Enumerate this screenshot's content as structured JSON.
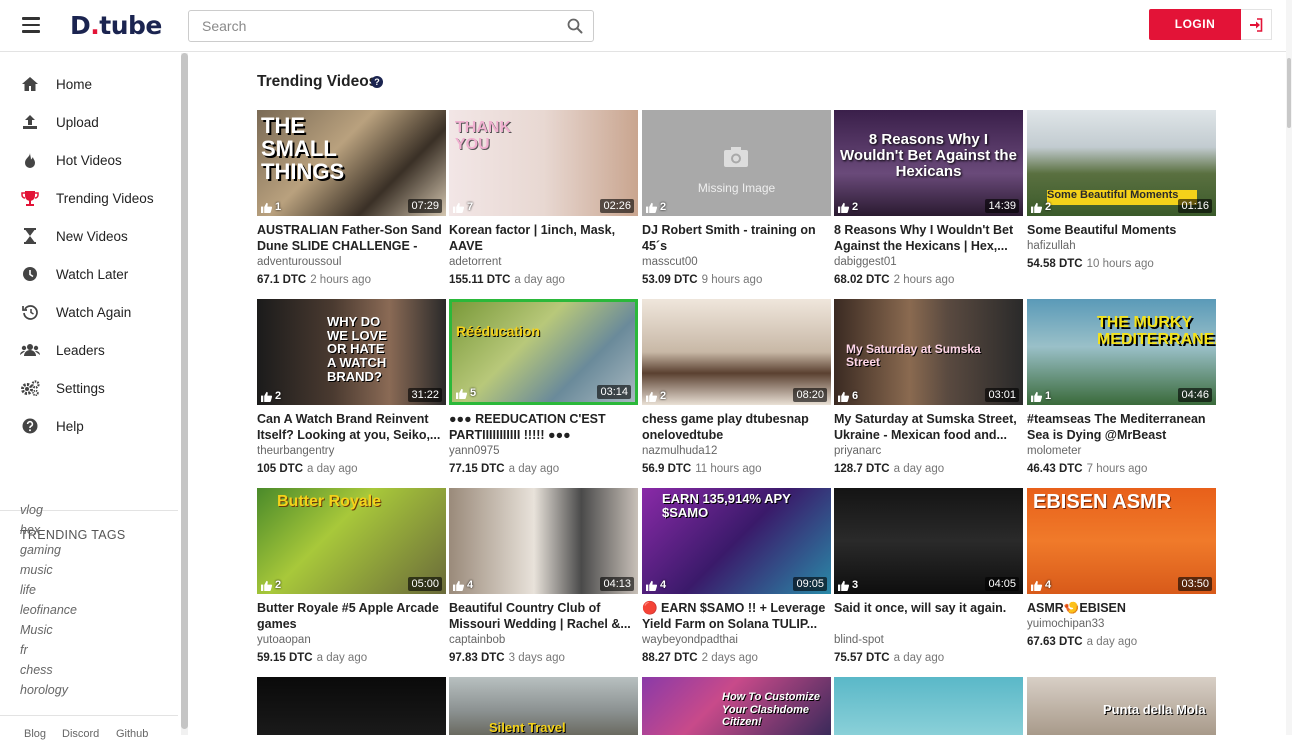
{
  "header": {
    "logo_d": "D",
    "logo_dot": ".",
    "logo_rest": "tube",
    "search_placeholder": "Search",
    "login_label": "LOGIN"
  },
  "sidebar": {
    "items": [
      {
        "label": "Home",
        "icon": "home-icon"
      },
      {
        "label": "Upload",
        "icon": "upload-icon"
      },
      {
        "label": "Hot Videos",
        "icon": "fire-icon"
      },
      {
        "label": "Trending Videos",
        "icon": "trophy-icon"
      },
      {
        "label": "New Videos",
        "icon": "hourglass-icon"
      },
      {
        "label": "Watch Later",
        "icon": "clock-icon"
      },
      {
        "label": "Watch Again",
        "icon": "history-icon"
      },
      {
        "label": "Leaders",
        "icon": "users-icon"
      },
      {
        "label": "Settings",
        "icon": "cogs-icon"
      },
      {
        "label": "Help",
        "icon": "question-icon"
      }
    ],
    "tags_title": "TRENDING TAGS",
    "tags": [
      "vlog",
      "hex",
      "gaming",
      "music",
      "life",
      "leofinance",
      "Music",
      "fr",
      "chess",
      "horology"
    ],
    "footer_links": [
      "Blog",
      "Discord",
      "Github"
    ]
  },
  "main": {
    "title": "Trending Videos",
    "videos": [
      {
        "title": "AUSTRALIAN Father-Son Sand Dune SLIDE CHALLENGE - The...",
        "author": "adventuroussoul",
        "dtc": "67.1 DTC",
        "ago": "2 hours ago",
        "likes": "1",
        "duration": "07:29",
        "overlay": "THE SMALL THINGS"
      },
      {
        "title": "Korean factor | 1inch, Mask, AAVE",
        "author": "adetorrent",
        "dtc": "155.11 DTC",
        "ago": "a day ago",
        "likes": "7",
        "duration": "02:26",
        "overlay": "THANK YOU"
      },
      {
        "title": "DJ Robert Smith - training on 45´s",
        "author": "masscut00",
        "dtc": "53.09 DTC",
        "ago": "9 hours ago",
        "likes": "2",
        "duration": "",
        "overlay": "Missing Image"
      },
      {
        "title": "8 Reasons Why I Wouldn't Bet Against the Hexicans | Hex,...",
        "author": "dabiggest01",
        "dtc": "68.02 DTC",
        "ago": "2 hours ago",
        "likes": "2",
        "duration": "14:39",
        "overlay": "8 Reasons Why I Wouldn't Bet Against the Hexicans"
      },
      {
        "title": "Some Beautiful Moments",
        "author": "hafizullah",
        "dtc": "54.58 DTC",
        "ago": "10 hours ago",
        "likes": "2",
        "duration": "01:16",
        "overlay": "Some Beautiful Moments"
      },
      {
        "title": "Can A Watch Brand Reinvent Itself? Looking at you, Seiko,...",
        "author": "theurbangentry",
        "dtc": "105 DTC",
        "ago": "a day ago",
        "likes": "2",
        "duration": "31:22",
        "overlay": "WHY DO WE LOVE OR HATE A WATCH BRAND?"
      },
      {
        "title": "●●● REEDUCATION C'EST PARTIIIIIIIIIII !!!!! ●●●",
        "author": "yann0975",
        "dtc": "77.15 DTC",
        "ago": "a day ago",
        "likes": "5",
        "duration": "03:14",
        "overlay": "Rééducation"
      },
      {
        "title": "chess game play dtubesnap onelovedtube",
        "author": "nazmulhuda12",
        "dtc": "56.9 DTC",
        "ago": "11 hours ago",
        "likes": "2",
        "duration": "08:20",
        "overlay": ""
      },
      {
        "title": "My Saturday at Sumska Street, Ukraine - Mexican food and...",
        "author": "priyanarc",
        "dtc": "128.7 DTC",
        "ago": "a day ago",
        "likes": "6",
        "duration": "03:01",
        "overlay": "My Saturday at Sumska Street"
      },
      {
        "title": "#teamseas The Mediterranean Sea is Dying @MrBeast @Mark...",
        "author": "molometer",
        "dtc": "46.43 DTC",
        "ago": "7 hours ago",
        "likes": "1",
        "duration": "04:46",
        "overlay": "THE MURKY MEDITERRANEAN"
      },
      {
        "title": "Butter Royale #5 Apple Arcade games",
        "author": "yutoaopan",
        "dtc": "59.15 DTC",
        "ago": "a day ago",
        "likes": "2",
        "duration": "05:00",
        "overlay": "Butter Royale"
      },
      {
        "title": "Beautiful Country Club of Missouri Wedding | Rachel &...",
        "author": "captainbob",
        "dtc": "97.83 DTC",
        "ago": "3 days ago",
        "likes": "4",
        "duration": "04:13",
        "overlay": ""
      },
      {
        "title": "🔴 EARN $SAMO !! + Leverage Yield Farm on Solana TULIP...",
        "author": "waybeyondpadthai",
        "dtc": "88.27 DTC",
        "ago": "2 days ago",
        "likes": "4",
        "duration": "09:05",
        "overlay": "EARN 135,914% APY $SAMO"
      },
      {
        "title": "Said it once, will say it again.",
        "author": "blind-spot",
        "dtc": "75.57 DTC",
        "ago": "a day ago",
        "likes": "3",
        "duration": "04:05",
        "overlay": ""
      },
      {
        "title": "ASMR🍤EBISEN",
        "author": "yuimochipan33",
        "dtc": "67.63 DTC",
        "ago": "a day ago",
        "likes": "4",
        "duration": "03:50",
        "overlay": "EBISEN ASMR"
      }
    ],
    "partial_row": [
      {
        "overlay": ""
      },
      {
        "overlay": "Silent Travel"
      },
      {
        "overlay": "How To Customize Your Clashdome Citizen!"
      },
      {
        "overlay": ""
      },
      {
        "overlay": "Punta della Mola"
      }
    ]
  }
}
